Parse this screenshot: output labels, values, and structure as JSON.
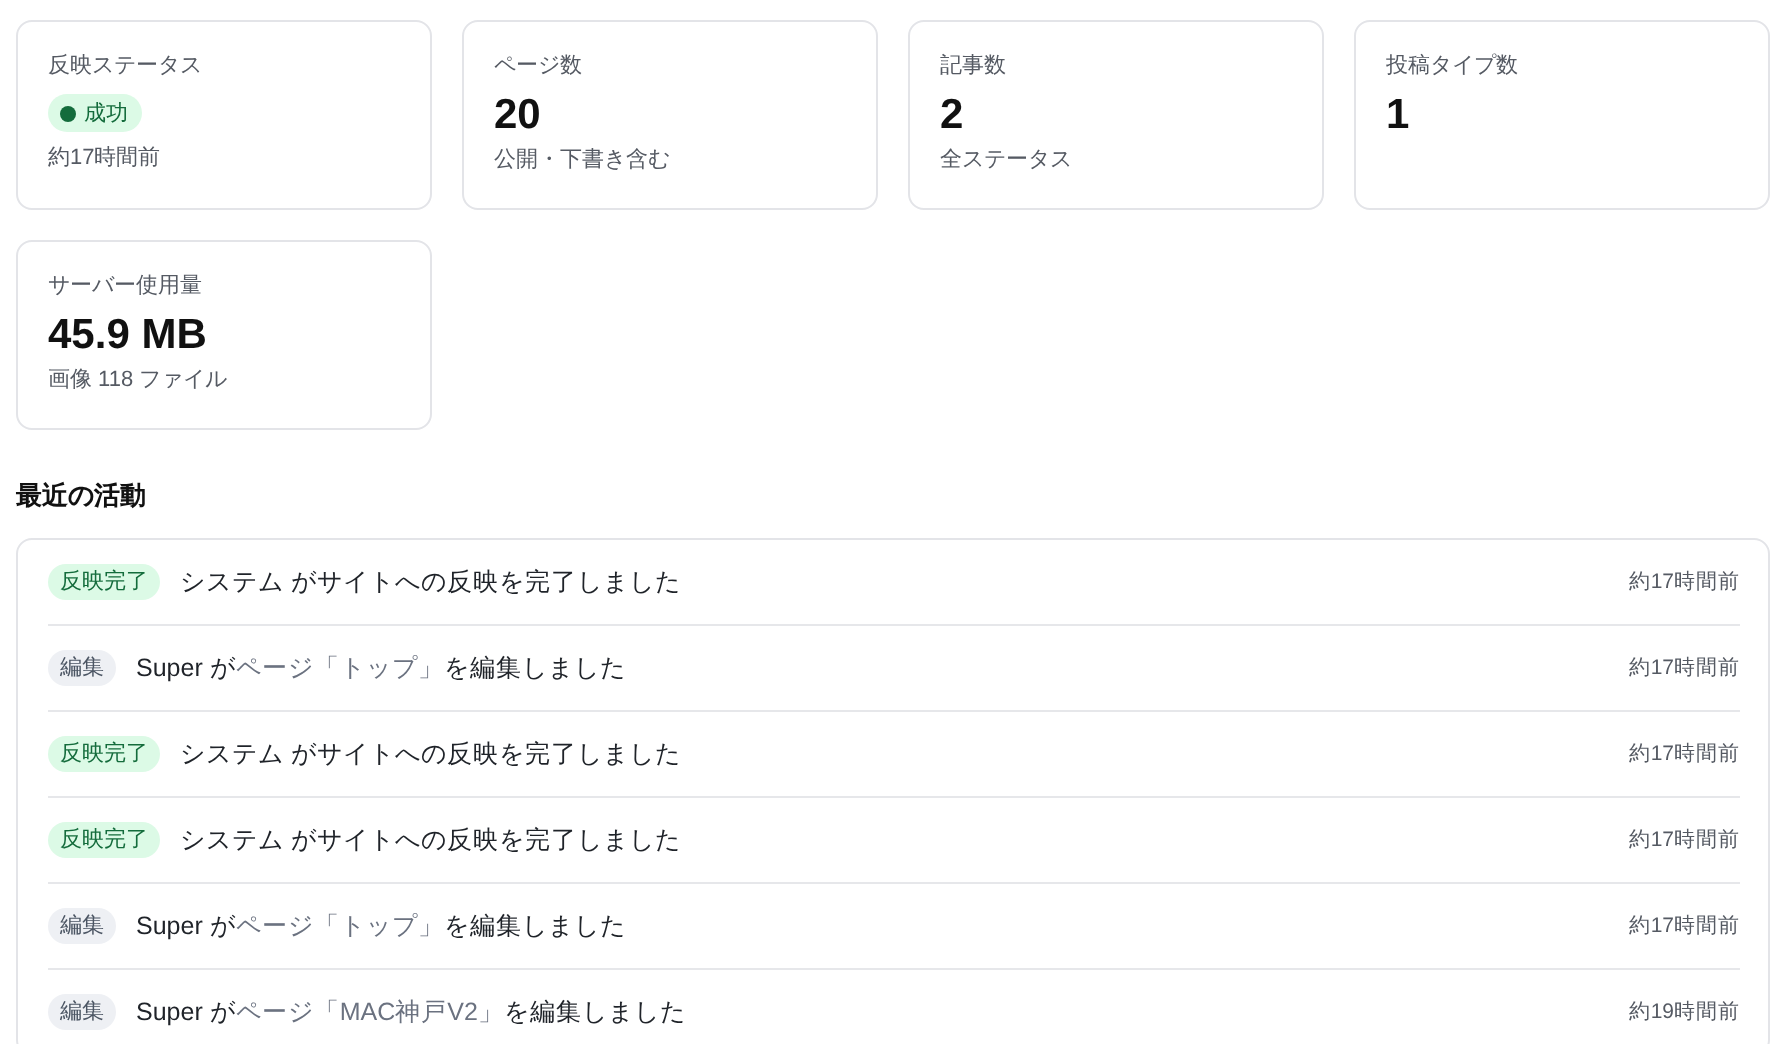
{
  "stats": [
    {
      "label": "反映ステータス",
      "status": {
        "text": "成功",
        "ok": true
      },
      "note": "約17時間前"
    },
    {
      "label": "ページ数",
      "value": "20",
      "note": "公開・下書き含む"
    },
    {
      "label": "記事数",
      "value": "2",
      "note": "全ステータス"
    },
    {
      "label": "投稿タイプ数",
      "value": "1"
    },
    {
      "label": "サーバー使用量",
      "value": "45.9 MB",
      "note": "画像 118 ファイル"
    }
  ],
  "activity": {
    "title": "最近の活動",
    "items": [
      {
        "kind": "deploy",
        "badge": "反映完了",
        "parts": [
          {
            "text": "システム がサイトへの反映を完了しました",
            "muted": false
          }
        ],
        "time": "約17時間前"
      },
      {
        "kind": "edit",
        "badge": "編集",
        "parts": [
          {
            "text": "Super が",
            "muted": false
          },
          {
            "text": "ページ「トップ」",
            "muted": true
          },
          {
            "text": "を編集しました",
            "muted": false
          }
        ],
        "time": "約17時間前"
      },
      {
        "kind": "deploy",
        "badge": "反映完了",
        "parts": [
          {
            "text": "システム がサイトへの反映を完了しました",
            "muted": false
          }
        ],
        "time": "約17時間前"
      },
      {
        "kind": "deploy",
        "badge": "反映完了",
        "parts": [
          {
            "text": "システム がサイトへの反映を完了しました",
            "muted": false
          }
        ],
        "time": "約17時間前"
      },
      {
        "kind": "edit",
        "badge": "編集",
        "parts": [
          {
            "text": "Super が",
            "muted": false
          },
          {
            "text": "ページ「トップ」",
            "muted": true
          },
          {
            "text": "を編集しました",
            "muted": false
          }
        ],
        "time": "約17時間前"
      },
      {
        "kind": "edit",
        "badge": "編集",
        "parts": [
          {
            "text": "Super が",
            "muted": false
          },
          {
            "text": "ページ「MAC神戸V2」",
            "muted": true
          },
          {
            "text": "を編集しました",
            "muted": false
          }
        ],
        "time": "約19時間前"
      }
    ]
  }
}
